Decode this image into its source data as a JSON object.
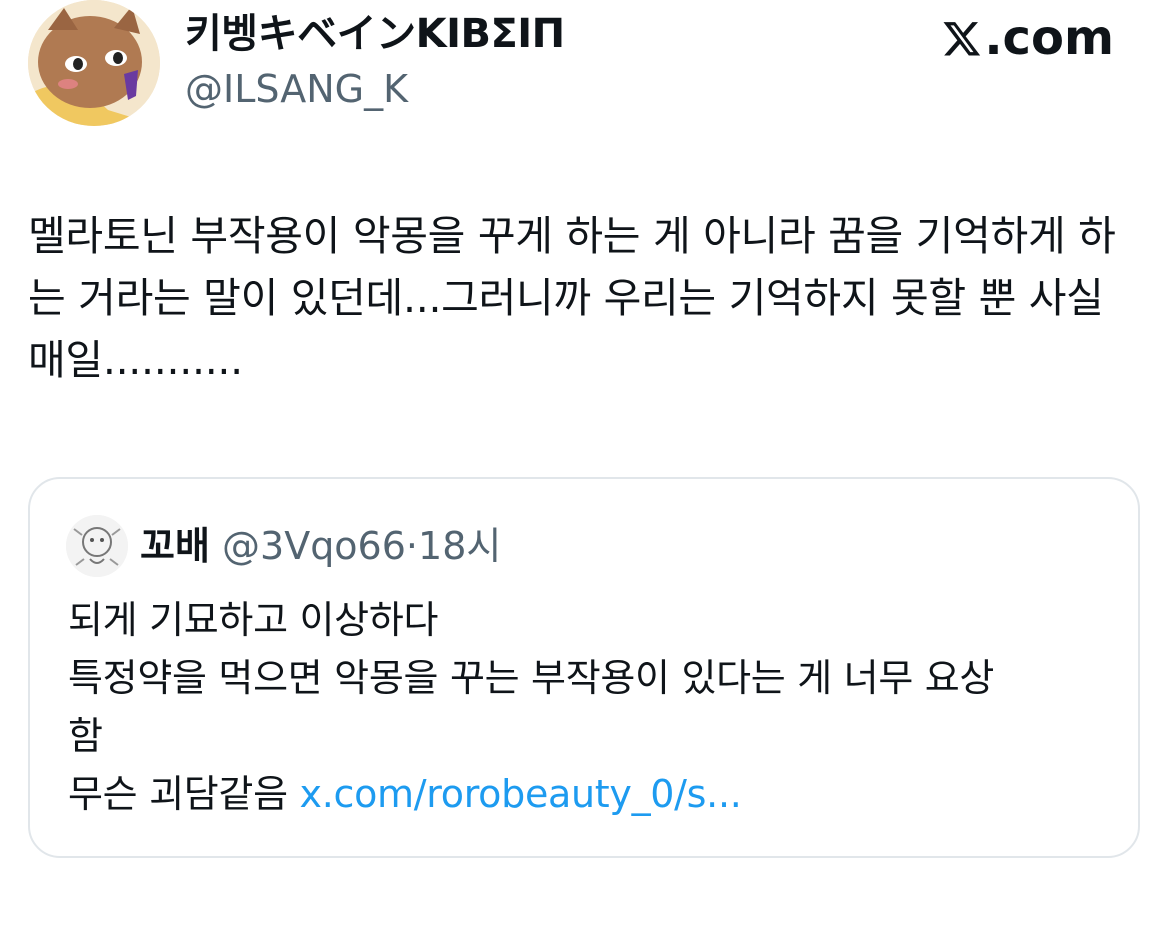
{
  "author": {
    "display_name": "키벵キベインΚΙΒΣΙΠ",
    "handle": "@ILSANG_K",
    "avatar_icon": "cartoon-cat-avatar"
  },
  "brand": {
    "label": ".com",
    "icon": "x-logo-icon"
  },
  "tweet": {
    "text": "멜라토닌 부작용이 악몽을 꾸게 하는 게 아니라 꿈을 기억하게 하는 거라는 말이 있던데...그러니까 우리는 기억하지 못할 뿐 사실 매일..........."
  },
  "quote": {
    "display_name": "꼬배",
    "handle": "@3Vqo66",
    "separator": "·",
    "time": "18시",
    "avatar_icon": "doodle-avatar",
    "lines": [
      "되게 기묘하고 이상하다",
      "특정약을 먹으면 악몽을 꾸는 부작용이 있다는 게 너무 요상",
      "함",
      "무슨 괴담같음"
    ],
    "link": "x.com/rorobeauty_0/s..."
  },
  "colors": {
    "text": "#0f1419",
    "secondary": "#536471",
    "link": "#1d9bf0",
    "border": "#e1e6ea"
  }
}
